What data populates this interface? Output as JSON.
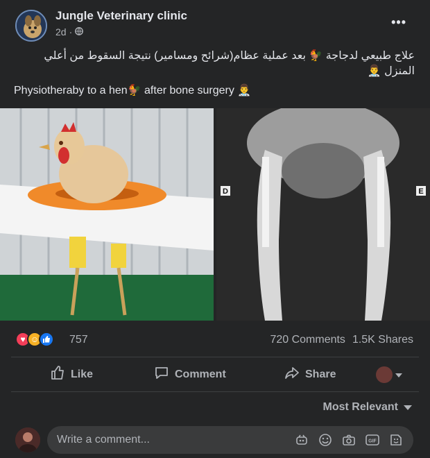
{
  "post": {
    "page_name": "Jungle Veterinary clinic",
    "time": "2d",
    "text_ar": "علاج طبيعي لدجاجة 🐓 بعد عملية عظام(شرائح ومسامير) نتيجة السقوط من أعلي المنزل 👨‍⚕️",
    "text_en": "Physiotheraby to a hen🐓 after bone surgery 👨‍⚕️",
    "xray_left_marker": "D",
    "xray_right_marker": "E"
  },
  "stats": {
    "reactions_count": "757",
    "comments": "720 Comments",
    "shares": "1.5K Shares"
  },
  "actions": {
    "like": "Like",
    "comment": "Comment",
    "share": "Share"
  },
  "comments": {
    "sort_label": "Most Relevant",
    "placeholder": "Write a comment..."
  },
  "colors": {
    "background": "#242526",
    "like_blue": "#1877f2",
    "love_red": "#f33e58",
    "haha_yellow": "#f7b125"
  },
  "icons": [
    "globe-icon",
    "more-icon",
    "like-icon",
    "comment-icon",
    "share-icon",
    "chevron-down-icon",
    "sticker-icon",
    "emoji-icon",
    "camera-icon",
    "gif-icon",
    "sticker-face-icon"
  ]
}
